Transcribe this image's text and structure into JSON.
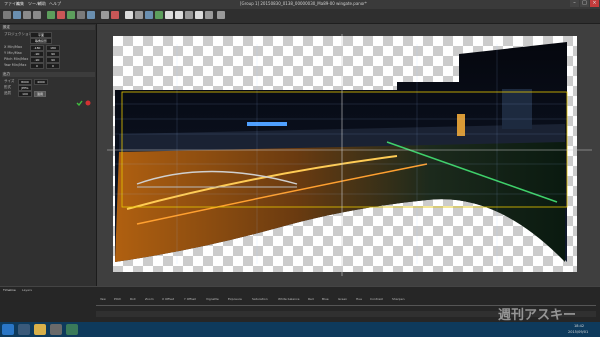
{
  "window": {
    "title": "[Group 1] 20150830_0138_00000030_Ma89-00 wingate.panor*"
  },
  "menu": {
    "items": [
      "ファイル",
      "編集",
      "ツール",
      "補助",
      "ヘルプ"
    ]
  },
  "panel": {
    "header1": "設定",
    "section_label": "プロジェクション",
    "projection_value": "平面",
    "sub_value": "等角投影",
    "rows": [
      {
        "label": "X Min/Max",
        "v1": "-180",
        "v2": "180"
      },
      {
        "label": "Y Min/Max",
        "v1": "-90",
        "v2": "90"
      },
      {
        "label": "Pitch Min/Max",
        "v1": "-90",
        "v2": "90"
      },
      {
        "label": "Yaw Min/Max",
        "v1": "0",
        "v2": "0"
      }
    ],
    "header2": "出力",
    "out_rows": [
      {
        "label": "サイズ",
        "v1": "8000",
        "v2": "4000"
      },
      {
        "label": "形式",
        "v1": "JPEG",
        "v2": ""
      },
      {
        "label": "品質",
        "v1": "100",
        "v2": "適用"
      }
    ]
  },
  "timeline": {
    "tabs": [
      "Timeline",
      "Layers"
    ],
    "labels": [
      "Yaw",
      "Pitch",
      "Roll",
      "Zoom",
      "X Offset",
      "Y Offset",
      "Vignette",
      "Exposure",
      "Saturation",
      "White balance",
      "Red",
      "Blue",
      "Green",
      "Hue",
      "Contrast",
      "Sharpen"
    ]
  },
  "taskbar": {
    "time": "18:42",
    "date": "2015/09/01"
  },
  "watermark": "週刊アスキー",
  "colors": {
    "accent_yellow": "#e6c700",
    "check_green": "#3fbf3f",
    "cancel_red": "#d23232",
    "taskbar": "#0e3a5c"
  }
}
